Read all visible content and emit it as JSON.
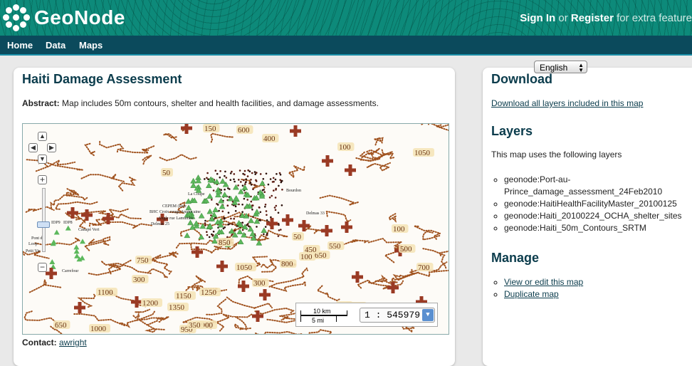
{
  "header": {
    "logo_text": "GeoNode",
    "sign_in": "Sign In",
    "or": "or",
    "register": "Register",
    "extra": "for extra feature"
  },
  "nav": {
    "items": [
      "Home",
      "Data",
      "Maps"
    ]
  },
  "language": {
    "selected": "English"
  },
  "map_page": {
    "title": "Haiti Damage Assessment",
    "abstract_label": "Abstract:",
    "abstract_text": "Map includes 50m contours, shelter and health facilities, and damage assessments.",
    "contact_label": "Contact:",
    "contact_value": "awright",
    "scale_km": "10 km",
    "scale_mi": "5 mi",
    "scale_value": "1 : 545979",
    "contour_labels": [
      "150",
      "600",
      "400",
      "1050",
      "100",
      "50",
      "100",
      "50",
      "700",
      "650",
      "100",
      "550",
      "850",
      "450",
      "750",
      "300",
      "1150",
      "1250",
      "1350",
      "1900",
      "950",
      "650",
      "1000",
      "1100",
      "1200",
      "1050",
      "450",
      "300",
      "350",
      "800",
      "500",
      "1250"
    ],
    "place_labels": [
      "La Coupe",
      "CEPEM (Parc",
      "BHC Croix rouge Américaine",
      "Angle rue Lamumba",
      "Delmas 25",
      "IDP9",
      "IDP8",
      "Canapé Vert",
      "Pont de",
      "Loop",
      "Petit Vie",
      "Carrefour",
      "Delmas 33",
      "Bourdon"
    ]
  },
  "sidebar": {
    "download_heading": "Download",
    "download_link": "Download all layers included in this map",
    "layers_heading": "Layers",
    "layers_text": "This map uses the following layers",
    "layers": [
      "geonode:Port-au-Prince_damage_assessment_24Feb2010",
      "geonode:HaitiHealthFacilityMaster_20100125",
      "geonode:Haiti_20100224_OCHA_shelter_sites",
      "geonode:Haiti_50m_Contours_SRTM"
    ],
    "manage_heading": "Manage",
    "manage_links": [
      "View or edit this map",
      "Duplicate map"
    ]
  },
  "colors": {
    "header_teal": "#0d8a7a",
    "nav_dark": "#0b4a5c",
    "heading": "#0b3c4c",
    "contour_brown": "#a0521e",
    "shelter_green": "#5cb85c",
    "health_cross": "#9a3a24"
  }
}
